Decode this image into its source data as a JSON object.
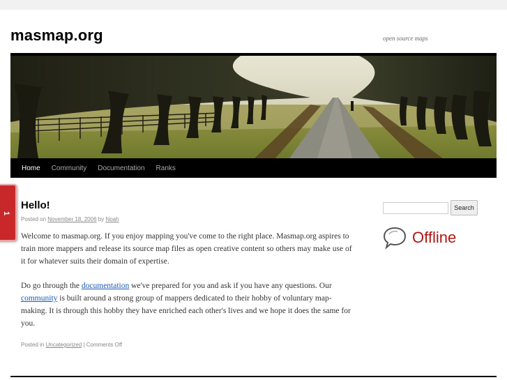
{
  "site": {
    "title": "masmap.org",
    "description": "open source maps"
  },
  "nav": {
    "items": [
      {
        "label": "Home",
        "current": true
      },
      {
        "label": "Community",
        "current": false
      },
      {
        "label": "Documentation",
        "current": false
      },
      {
        "label": "Ranks",
        "current": false
      }
    ]
  },
  "side_tab": {
    "label": "1"
  },
  "post": {
    "title": "Hello!",
    "meta": {
      "posted_on": "Posted on",
      "date": "November 18, 2006",
      "by": "by",
      "author": "Noah"
    },
    "paragraph1": "Welcome to masmap.org. If you enjoy mapping you've come to the right place. Masmap.org aspires to train more mappers and release its source map files as open creative content so others may make use of it for whatever suits their domain of expertise.",
    "p2_part1": "Do go through the ",
    "p2_link1": "documentation",
    "p2_part2": " we've prepared for you and ask if you have any questions. Our ",
    "p2_link2": "community",
    "p2_part3": " is built around a strong group of mappers dedicated to their hobby of voluntary map-making. It is through this hobby they have enriched each other's lives and we hope it does the same for you.",
    "utility": {
      "posted_in": "Posted in",
      "category": "Uncategorized",
      "separator": "|",
      "comments": "Comments Off"
    }
  },
  "sidebar": {
    "search_placeholder": "",
    "search_button": "Search",
    "status": "Offline",
    "status_color": "#b01515",
    "status_icon": "speech-bubble-icon"
  }
}
